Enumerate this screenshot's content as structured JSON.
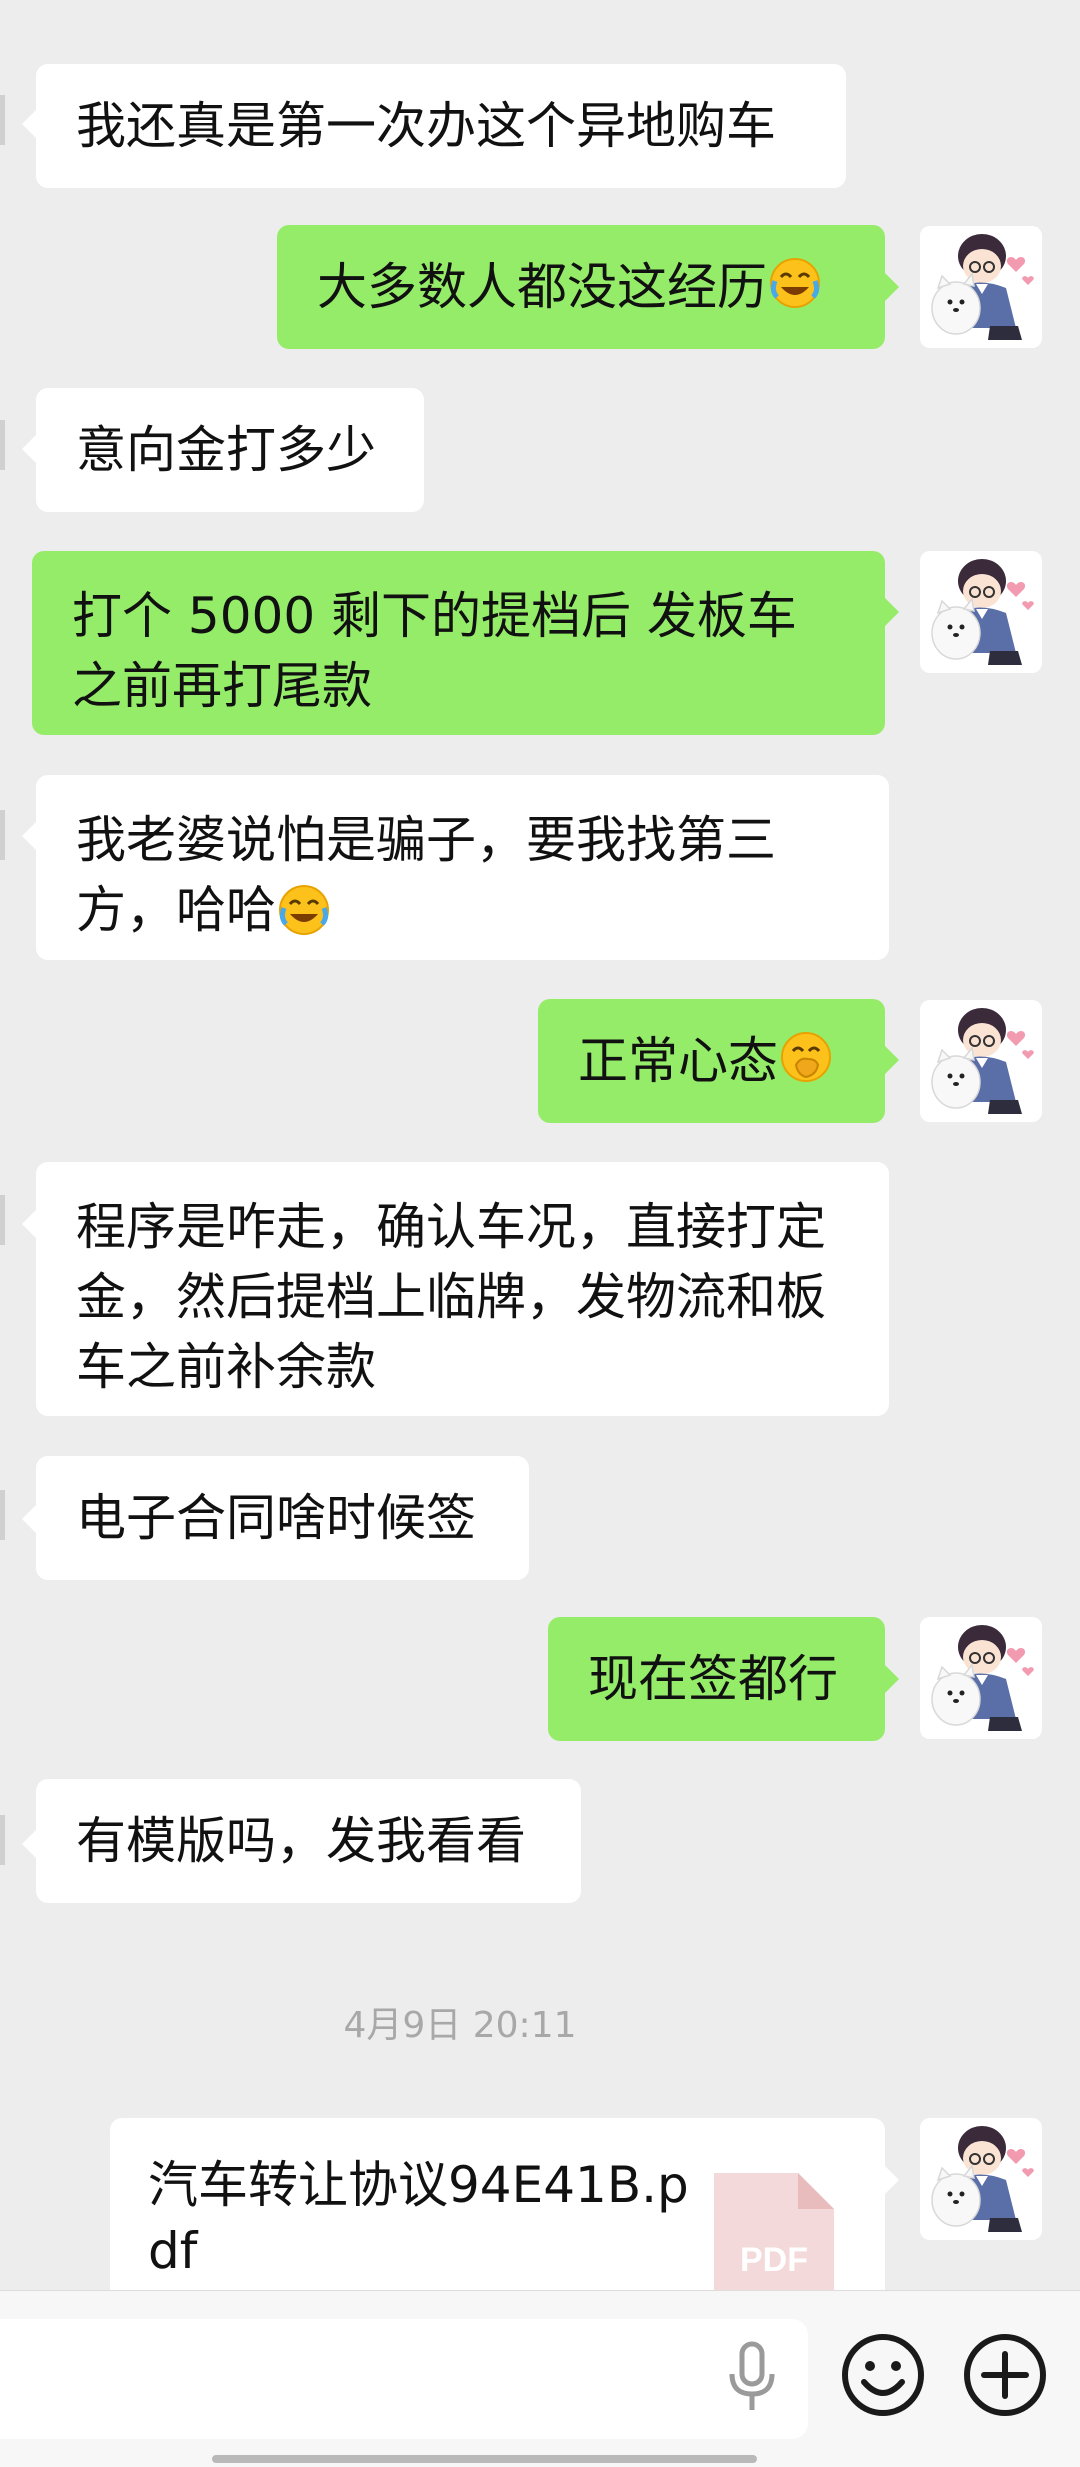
{
  "colors": {
    "background": "#ededed",
    "incoming_bubble": "#ffffff",
    "outgoing_bubble": "#95ec69",
    "timestamp_text": "#a8a8a8"
  },
  "messages": [
    {
      "side": "in",
      "text": "我还真是第一次办这个异地购车"
    },
    {
      "side": "out",
      "text": "大多数人都没这经历",
      "emoji": "crying-laughing-emoji"
    },
    {
      "side": "in",
      "text": "意向金打多少"
    },
    {
      "side": "out",
      "text": "打个 5000 剩下的提档后 发板车之前再打尾款"
    },
    {
      "side": "in",
      "text": "我老婆说怕是骗子，要我找第三方，哈哈",
      "emoji": "crying-laughing-emoji"
    },
    {
      "side": "out",
      "text": "正常心态",
      "emoji": "hand-over-mouth-emoji"
    },
    {
      "side": "in",
      "text": "程序是咋走，确认车况，直接打定金，然后提档上临牌，发物流和板车之前补余款"
    },
    {
      "side": "in",
      "text": "电子合同啥时候签"
    },
    {
      "side": "out",
      "text": "现在签都行"
    },
    {
      "side": "in",
      "text": "有模版吗，发我看看"
    }
  ],
  "timestamp": "4月9日 20:11",
  "file_message": {
    "side": "out",
    "file_name": "汽车转让协议94E41B.pdf",
    "file_type": "PDF",
    "icon": "pdf-file-icon"
  },
  "input_bar": {
    "icons": [
      "microphone-icon",
      "emoji-icon",
      "plus-icon"
    ]
  }
}
